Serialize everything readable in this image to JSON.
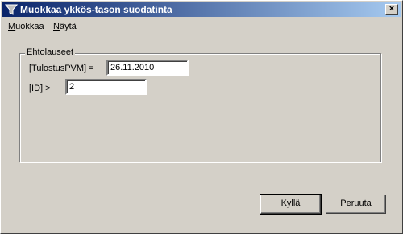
{
  "window": {
    "title": "Muokkaa ykkös-tason suodatinta",
    "icon": "filter-icon",
    "close_label": "×"
  },
  "menu": [
    {
      "first": "M",
      "rest": "uokkaa"
    },
    {
      "first": "N",
      "rest": "äytä"
    }
  ],
  "group": {
    "label": "Ehtolauseet",
    "conditions": [
      {
        "label": "[TulostusPVM] =",
        "value": "26.11.2010"
      },
      {
        "label": "[ID] >",
        "value": "2"
      }
    ]
  },
  "buttons": {
    "ok": {
      "first": "K",
      "rest": "yllä"
    },
    "cancel": "Peruuta"
  },
  "colors": {
    "titlebar_start": "#0a246a",
    "titlebar_end": "#a6caf0",
    "face": "#d4d0c8"
  }
}
